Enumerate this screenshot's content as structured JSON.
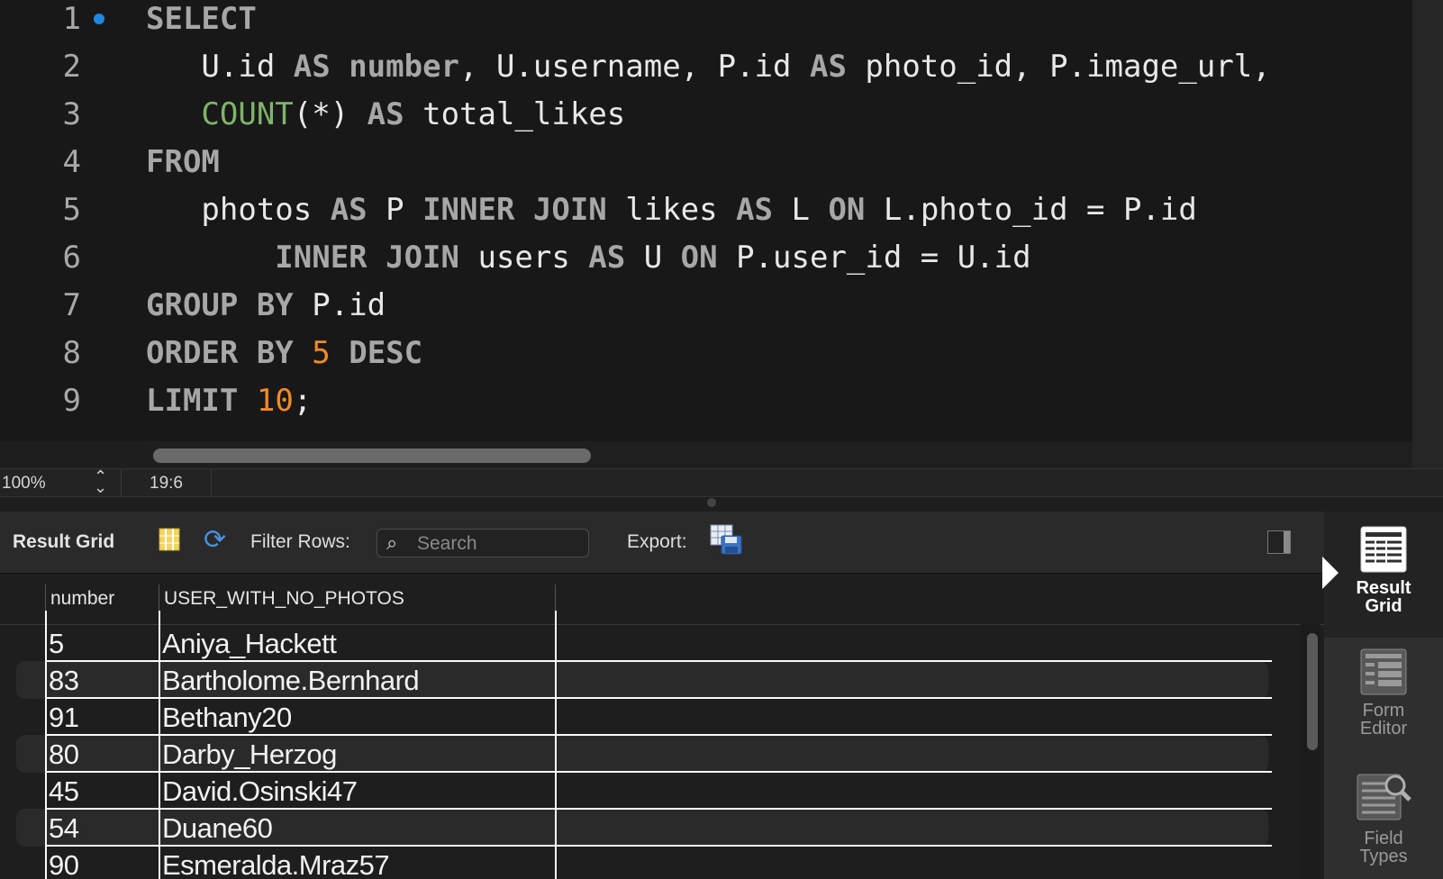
{
  "editor": {
    "line_numbers": [
      "1",
      "2",
      "3",
      "4",
      "5",
      "6",
      "7",
      "8",
      "9"
    ],
    "lines": [
      [
        {
          "t": "SELECT",
          "c": "kw"
        }
      ],
      [
        {
          "t": "   U.id "
        },
        {
          "t": "AS",
          "c": "kw"
        },
        {
          "t": " "
        },
        {
          "t": "number",
          "c": "kw"
        },
        {
          "t": ", U.username, P.id "
        },
        {
          "t": "AS",
          "c": "kw"
        },
        {
          "t": " photo_id, P.image_url,"
        }
      ],
      [
        {
          "t": "   "
        },
        {
          "t": "COUNT",
          "c": "fn"
        },
        {
          "t": "(*) "
        },
        {
          "t": "AS",
          "c": "kw"
        },
        {
          "t": " total_likes"
        }
      ],
      [
        {
          "t": "FROM",
          "c": "kw"
        }
      ],
      [
        {
          "t": "   photos "
        },
        {
          "t": "AS",
          "c": "kw"
        },
        {
          "t": " P "
        },
        {
          "t": "INNER JOIN",
          "c": "kw"
        },
        {
          "t": " likes "
        },
        {
          "t": "AS",
          "c": "kw"
        },
        {
          "t": " L "
        },
        {
          "t": "ON",
          "c": "kw"
        },
        {
          "t": " L.photo_id = P.id"
        }
      ],
      [
        {
          "t": "       "
        },
        {
          "t": "INNER JOIN",
          "c": "kw"
        },
        {
          "t": " users "
        },
        {
          "t": "AS",
          "c": "kw"
        },
        {
          "t": " U "
        },
        {
          "t": "ON",
          "c": "kw"
        },
        {
          "t": " P.user_id = U.id"
        }
      ],
      [
        {
          "t": "GROUP BY",
          "c": "kw"
        },
        {
          "t": " P.id"
        }
      ],
      [
        {
          "t": "ORDER BY",
          "c": "kw"
        },
        {
          "t": " "
        },
        {
          "t": "5",
          "c": "num"
        },
        {
          "t": " "
        },
        {
          "t": "DESC",
          "c": "kw"
        }
      ],
      [
        {
          "t": "LIMIT",
          "c": "kw"
        },
        {
          "t": " "
        },
        {
          "t": "10",
          "c": "num"
        },
        {
          "t": ";"
        }
      ]
    ]
  },
  "statusbar": {
    "zoom": "100%",
    "cursor_position": "19:6"
  },
  "toolbar": {
    "title": "Result Grid",
    "filter_label": "Filter Rows:",
    "search_placeholder": "Search",
    "export_label": "Export:"
  },
  "grid": {
    "columns": [
      "number",
      "USER_WITH_NO_PHOTOS"
    ],
    "rows": [
      [
        "5",
        "Aniya_Hackett"
      ],
      [
        "83",
        "Bartholome.Bernhard"
      ],
      [
        "91",
        "Bethany20"
      ],
      [
        "80",
        "Darby_Herzog"
      ],
      [
        "45",
        "David.Osinski47"
      ],
      [
        "54",
        "Duane60"
      ],
      [
        "90",
        "Esmeralda.Mraz57"
      ]
    ]
  },
  "sidepanel": {
    "items": [
      {
        "label_1": "Result",
        "label_2": "Grid",
        "active": true
      },
      {
        "label_1": "Form",
        "label_2": "Editor",
        "active": false
      },
      {
        "label_1": "Field",
        "label_2": "Types",
        "active": false
      }
    ]
  },
  "colors": {
    "keyword": "#a7a7a7",
    "function": "#7fb46a",
    "number_literal": "#f28b24",
    "breakpoint": "#1e88e5",
    "refresh_icon": "#4a8fe0"
  }
}
